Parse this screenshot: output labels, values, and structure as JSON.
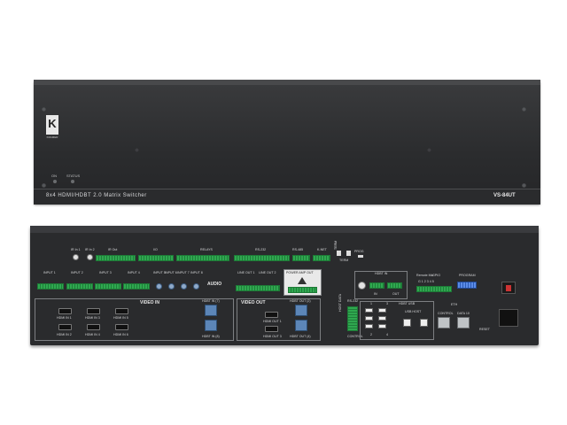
{
  "front": {
    "logo": "K",
    "logo_sub": "KRAMER",
    "led_on": "ON",
    "led_status": "STATUS",
    "title": "8x4 HDMI/HDBT 2.0 Matrix Switcher",
    "model": "VS-84UT"
  },
  "rear": {
    "ir_in_1": "IR In 1",
    "ir_in_2": "IR In 2",
    "ir_out": "IR Out",
    "io": "I/O",
    "relays": "RELAYS",
    "rs232": "RS-232",
    "rs485": "RS-485",
    "k_net": "K-NET",
    "term": "TERM",
    "reset": "RESET",
    "prog": "PROG",
    "input_1": "INPUT 1",
    "input_2": "INPUT 2",
    "input_3": "INPUT 3",
    "input_4": "INPUT 4",
    "input_5": "INPUT 5",
    "input_6": "INPUT 6",
    "input_7": "INPUT 7",
    "input_8": "INPUT 8",
    "audio": "AUDIO",
    "line_out_1": "LINE OUT 1",
    "line_out_2": "LINE OUT 2",
    "power_amp_out": "POWER AMP OUT",
    "hdbt_in_label": "HDBT IN",
    "in": "IN",
    "out": "OUT",
    "remote_mic": "Remote Mic",
    "gpio": "GPIO",
    "program": "PROGRAM",
    "gpio_nums": "G 1 2 3 4 5",
    "video_in": "VIDEO IN",
    "hdmi_in_1": "HDMI IN 1",
    "hdmi_in_2": "HDMI IN 2",
    "hdmi_in_3": "HDMI IN 3",
    "hdmi_in_4": "HDMI IN 4",
    "hdmi_in_5": "HDMI IN 5",
    "hdmi_in_6": "HDMI IN 6",
    "hdbt_in_7": "HDBT IN (7)",
    "hdbt_in_8": "HDBT IN (8)",
    "video_out": "VIDEO OUT",
    "hdmi_out_1": "HDMI OUT 1",
    "hdmi_out_3": "HDMI OUT 3",
    "hdbt_out_2": "HDBT OUT (2)",
    "hdbt_out_4": "HDBT OUT (4)",
    "rs232_ctrl": "RS-232",
    "host_data": "HOST DATA",
    "control": "CONTROL",
    "hdbt_usb": "HDBT USB",
    "usb_host": "USB HOST",
    "eth": "ETH",
    "control_eth": "CONTROL",
    "data_10": "DATA 10",
    "usb_1": "1",
    "usb_2": "2",
    "usb_3": "3",
    "usb_4": "4"
  }
}
